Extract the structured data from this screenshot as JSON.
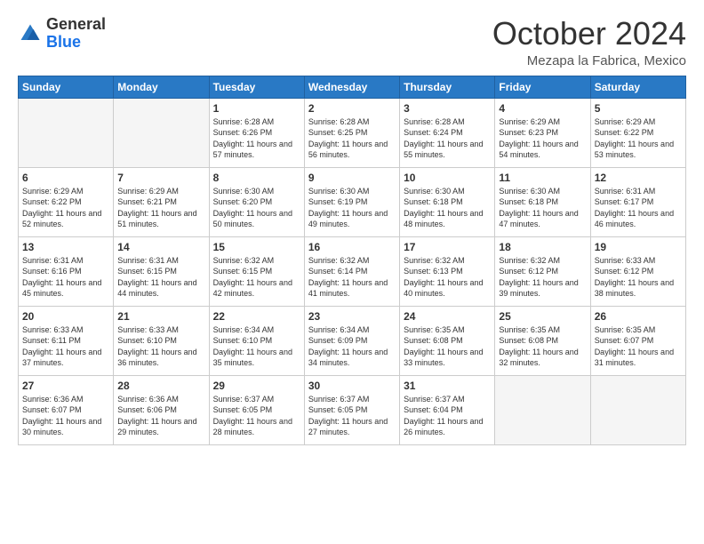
{
  "header": {
    "logo_general": "General",
    "logo_blue": "Blue",
    "month_title": "October 2024",
    "location": "Mezapa la Fabrica, Mexico"
  },
  "weekdays": [
    "Sunday",
    "Monday",
    "Tuesday",
    "Wednesday",
    "Thursday",
    "Friday",
    "Saturday"
  ],
  "weeks": [
    [
      {
        "day": "",
        "empty": true
      },
      {
        "day": "",
        "empty": true
      },
      {
        "day": "1",
        "sunrise": "Sunrise: 6:28 AM",
        "sunset": "Sunset: 6:26 PM",
        "daylight": "Daylight: 11 hours and 57 minutes."
      },
      {
        "day": "2",
        "sunrise": "Sunrise: 6:28 AM",
        "sunset": "Sunset: 6:25 PM",
        "daylight": "Daylight: 11 hours and 56 minutes."
      },
      {
        "day": "3",
        "sunrise": "Sunrise: 6:28 AM",
        "sunset": "Sunset: 6:24 PM",
        "daylight": "Daylight: 11 hours and 55 minutes."
      },
      {
        "day": "4",
        "sunrise": "Sunrise: 6:29 AM",
        "sunset": "Sunset: 6:23 PM",
        "daylight": "Daylight: 11 hours and 54 minutes."
      },
      {
        "day": "5",
        "sunrise": "Sunrise: 6:29 AM",
        "sunset": "Sunset: 6:22 PM",
        "daylight": "Daylight: 11 hours and 53 minutes."
      }
    ],
    [
      {
        "day": "6",
        "sunrise": "Sunrise: 6:29 AM",
        "sunset": "Sunset: 6:22 PM",
        "daylight": "Daylight: 11 hours and 52 minutes."
      },
      {
        "day": "7",
        "sunrise": "Sunrise: 6:29 AM",
        "sunset": "Sunset: 6:21 PM",
        "daylight": "Daylight: 11 hours and 51 minutes."
      },
      {
        "day": "8",
        "sunrise": "Sunrise: 6:30 AM",
        "sunset": "Sunset: 6:20 PM",
        "daylight": "Daylight: 11 hours and 50 minutes."
      },
      {
        "day": "9",
        "sunrise": "Sunrise: 6:30 AM",
        "sunset": "Sunset: 6:19 PM",
        "daylight": "Daylight: 11 hours and 49 minutes."
      },
      {
        "day": "10",
        "sunrise": "Sunrise: 6:30 AM",
        "sunset": "Sunset: 6:18 PM",
        "daylight": "Daylight: 11 hours and 48 minutes."
      },
      {
        "day": "11",
        "sunrise": "Sunrise: 6:30 AM",
        "sunset": "Sunset: 6:18 PM",
        "daylight": "Daylight: 11 hours and 47 minutes."
      },
      {
        "day": "12",
        "sunrise": "Sunrise: 6:31 AM",
        "sunset": "Sunset: 6:17 PM",
        "daylight": "Daylight: 11 hours and 46 minutes."
      }
    ],
    [
      {
        "day": "13",
        "sunrise": "Sunrise: 6:31 AM",
        "sunset": "Sunset: 6:16 PM",
        "daylight": "Daylight: 11 hours and 45 minutes."
      },
      {
        "day": "14",
        "sunrise": "Sunrise: 6:31 AM",
        "sunset": "Sunset: 6:15 PM",
        "daylight": "Daylight: 11 hours and 44 minutes."
      },
      {
        "day": "15",
        "sunrise": "Sunrise: 6:32 AM",
        "sunset": "Sunset: 6:15 PM",
        "daylight": "Daylight: 11 hours and 42 minutes."
      },
      {
        "day": "16",
        "sunrise": "Sunrise: 6:32 AM",
        "sunset": "Sunset: 6:14 PM",
        "daylight": "Daylight: 11 hours and 41 minutes."
      },
      {
        "day": "17",
        "sunrise": "Sunrise: 6:32 AM",
        "sunset": "Sunset: 6:13 PM",
        "daylight": "Daylight: 11 hours and 40 minutes."
      },
      {
        "day": "18",
        "sunrise": "Sunrise: 6:32 AM",
        "sunset": "Sunset: 6:12 PM",
        "daylight": "Daylight: 11 hours and 39 minutes."
      },
      {
        "day": "19",
        "sunrise": "Sunrise: 6:33 AM",
        "sunset": "Sunset: 6:12 PM",
        "daylight": "Daylight: 11 hours and 38 minutes."
      }
    ],
    [
      {
        "day": "20",
        "sunrise": "Sunrise: 6:33 AM",
        "sunset": "Sunset: 6:11 PM",
        "daylight": "Daylight: 11 hours and 37 minutes."
      },
      {
        "day": "21",
        "sunrise": "Sunrise: 6:33 AM",
        "sunset": "Sunset: 6:10 PM",
        "daylight": "Daylight: 11 hours and 36 minutes."
      },
      {
        "day": "22",
        "sunrise": "Sunrise: 6:34 AM",
        "sunset": "Sunset: 6:10 PM",
        "daylight": "Daylight: 11 hours and 35 minutes."
      },
      {
        "day": "23",
        "sunrise": "Sunrise: 6:34 AM",
        "sunset": "Sunset: 6:09 PM",
        "daylight": "Daylight: 11 hours and 34 minutes."
      },
      {
        "day": "24",
        "sunrise": "Sunrise: 6:35 AM",
        "sunset": "Sunset: 6:08 PM",
        "daylight": "Daylight: 11 hours and 33 minutes."
      },
      {
        "day": "25",
        "sunrise": "Sunrise: 6:35 AM",
        "sunset": "Sunset: 6:08 PM",
        "daylight": "Daylight: 11 hours and 32 minutes."
      },
      {
        "day": "26",
        "sunrise": "Sunrise: 6:35 AM",
        "sunset": "Sunset: 6:07 PM",
        "daylight": "Daylight: 11 hours and 31 minutes."
      }
    ],
    [
      {
        "day": "27",
        "sunrise": "Sunrise: 6:36 AM",
        "sunset": "Sunset: 6:07 PM",
        "daylight": "Daylight: 11 hours and 30 minutes."
      },
      {
        "day": "28",
        "sunrise": "Sunrise: 6:36 AM",
        "sunset": "Sunset: 6:06 PM",
        "daylight": "Daylight: 11 hours and 29 minutes."
      },
      {
        "day": "29",
        "sunrise": "Sunrise: 6:37 AM",
        "sunset": "Sunset: 6:05 PM",
        "daylight": "Daylight: 11 hours and 28 minutes."
      },
      {
        "day": "30",
        "sunrise": "Sunrise: 6:37 AM",
        "sunset": "Sunset: 6:05 PM",
        "daylight": "Daylight: 11 hours and 27 minutes."
      },
      {
        "day": "31",
        "sunrise": "Sunrise: 6:37 AM",
        "sunset": "Sunset: 6:04 PM",
        "daylight": "Daylight: 11 hours and 26 minutes."
      },
      {
        "day": "",
        "empty": true
      },
      {
        "day": "",
        "empty": true
      }
    ]
  ]
}
